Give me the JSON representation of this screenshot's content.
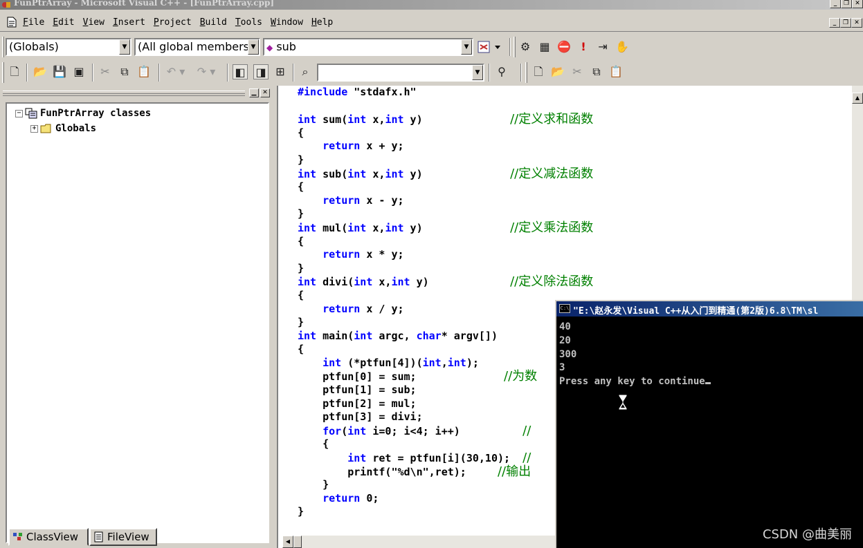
{
  "window": {
    "title": "FunPtrArray - Microsoft Visual C++ - [FunPtrArray.cpp]",
    "caption_buttons": [
      "_",
      "❐",
      "✕"
    ]
  },
  "menu": {
    "items": [
      {
        "acc": "F",
        "rest": "ile"
      },
      {
        "acc": "E",
        "rest": "dit"
      },
      {
        "acc": "V",
        "rest": "iew"
      },
      {
        "acc": "I",
        "rest": "nsert"
      },
      {
        "acc": "P",
        "rest": "roject"
      },
      {
        "acc": "B",
        "rest": "uild"
      },
      {
        "acc": "T",
        "rest": "ools"
      },
      {
        "acc": "W",
        "rest": "indow"
      },
      {
        "acc": "H",
        "rest": "elp"
      }
    ]
  },
  "wizardbar": {
    "class_combo": "(Globals)",
    "filter_combo": "(All global members",
    "member_combo": "sub"
  },
  "toolbar2": {
    "find_combo": ""
  },
  "workspace": {
    "root_label": "FunPtrArray classes",
    "child_label": "Globals",
    "tabs": {
      "classview": "ClassView",
      "fileview": "FileView"
    }
  },
  "editor": {
    "lines": [
      [
        [
          "pp",
          "#include"
        ],
        [
          "t",
          " \"stdafx.h\""
        ]
      ],
      [],
      [
        [
          "kw",
          "int"
        ],
        [
          "t",
          " sum("
        ],
        [
          "kw",
          "int"
        ],
        [
          "t",
          " x,"
        ],
        [
          "kw",
          "int"
        ],
        [
          "t",
          " y)              "
        ],
        [
          "cm",
          "//定义求和函数"
        ]
      ],
      [
        [
          "t",
          "{"
        ]
      ],
      [
        [
          "t",
          "    "
        ],
        [
          "kw",
          "return"
        ],
        [
          "t",
          " x + y;"
        ]
      ],
      [
        [
          "t",
          "}"
        ]
      ],
      [
        [
          "kw",
          "int"
        ],
        [
          "t",
          " sub("
        ],
        [
          "kw",
          "int"
        ],
        [
          "t",
          " x,"
        ],
        [
          "kw",
          "int"
        ],
        [
          "t",
          " y)              "
        ],
        [
          "cm",
          "//定义减法函数"
        ]
      ],
      [
        [
          "t",
          "{"
        ]
      ],
      [
        [
          "t",
          "    "
        ],
        [
          "kw",
          "return"
        ],
        [
          "t",
          " x - y;"
        ]
      ],
      [
        [
          "t",
          "}"
        ]
      ],
      [
        [
          "kw",
          "int"
        ],
        [
          "t",
          " mul("
        ],
        [
          "kw",
          "int"
        ],
        [
          "t",
          " x,"
        ],
        [
          "kw",
          "int"
        ],
        [
          "t",
          " y)              "
        ],
        [
          "cm",
          "//定义乘法函数"
        ]
      ],
      [
        [
          "t",
          "{"
        ]
      ],
      [
        [
          "t",
          "    "
        ],
        [
          "kw",
          "return"
        ],
        [
          "t",
          " x * y;"
        ]
      ],
      [
        [
          "t",
          "}"
        ]
      ],
      [
        [
          "kw",
          "int"
        ],
        [
          "t",
          " divi("
        ],
        [
          "kw",
          "int"
        ],
        [
          "t",
          " x,"
        ],
        [
          "kw",
          "int"
        ],
        [
          "t",
          " y)             "
        ],
        [
          "cm",
          "//定义除法函数"
        ]
      ],
      [
        [
          "t",
          "{"
        ]
      ],
      [
        [
          "t",
          "    "
        ],
        [
          "kw",
          "return"
        ],
        [
          "t",
          " x / y;"
        ]
      ],
      [
        [
          "t",
          "}"
        ]
      ],
      [
        [
          "kw",
          "int"
        ],
        [
          "t",
          " main("
        ],
        [
          "kw",
          "int"
        ],
        [
          "t",
          " argc, "
        ],
        [
          "kw",
          "char"
        ],
        [
          "t",
          "* argv[])"
        ]
      ],
      [
        [
          "t",
          "{"
        ]
      ],
      [
        [
          "t",
          "    "
        ],
        [
          "kw",
          "int"
        ],
        [
          "t",
          " (*ptfun[4])("
        ],
        [
          "kw",
          "int"
        ],
        [
          "t",
          ","
        ],
        [
          "kw",
          "int"
        ],
        [
          "t",
          ");"
        ]
      ],
      [
        [
          "t",
          "    ptfun[0] = sum;              "
        ],
        [
          "cm",
          "//为数"
        ]
      ],
      [
        [
          "t",
          "    ptfun[1] = sub;"
        ]
      ],
      [
        [
          "t",
          "    ptfun[2] = mul;"
        ]
      ],
      [
        [
          "t",
          "    ptfun[3] = divi;"
        ]
      ],
      [
        [
          "t",
          "    "
        ],
        [
          "kw",
          "for"
        ],
        [
          "t",
          "("
        ],
        [
          "kw",
          "int"
        ],
        [
          "t",
          " i=0; i<4; i++)          "
        ],
        [
          "cm",
          "//"
        ]
      ],
      [
        [
          "t",
          "    {"
        ]
      ],
      [
        [
          "t",
          "        "
        ],
        [
          "kw",
          "int"
        ],
        [
          "t",
          " ret = ptfun[i](30,10);  "
        ],
        [
          "cm",
          "//"
        ]
      ],
      [
        [
          "t",
          "        printf(\"%d\\n\",ret);     "
        ],
        [
          "cm",
          "//输出"
        ]
      ],
      [
        [
          "t",
          "    }"
        ]
      ],
      [
        [
          "t",
          "    "
        ],
        [
          "kw",
          "return"
        ],
        [
          "t",
          " 0;"
        ]
      ],
      [
        [
          "t",
          "}"
        ]
      ]
    ]
  },
  "console": {
    "title": "\"E:\\赵永发\\Visual C++从入门到精通(第2版)6.8\\TM\\sl",
    "output": [
      "40",
      "20",
      "300",
      "3",
      "Press any key to continue"
    ]
  },
  "watermark": "CSDN @曲美丽"
}
